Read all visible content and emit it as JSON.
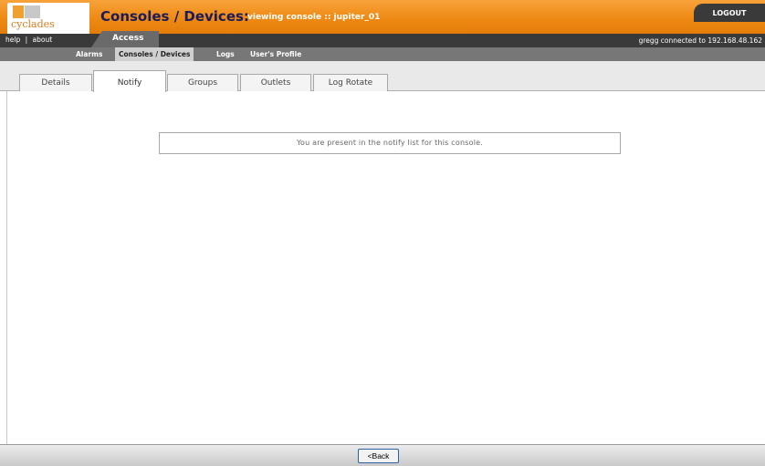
{
  "header": {
    "logo_text": "cyclades",
    "title": "Consoles / Devices:",
    "viewing": "viewing console :: jupiter_01",
    "logout_label": "LOGOUT"
  },
  "topbar": {
    "help_label": "help",
    "separator": "|",
    "about_label": "about",
    "access_label": "Access",
    "connected_text": "gregg connected to 192.168.48.162"
  },
  "subnav": {
    "items": [
      {
        "label": "Alarms"
      },
      {
        "label": "Consoles / Devices",
        "active": true
      },
      {
        "label": "Logs"
      },
      {
        "label": "User's Profile"
      }
    ]
  },
  "tabs": [
    {
      "label": "Details"
    },
    {
      "label": "Notify",
      "active": true
    },
    {
      "label": "Groups"
    },
    {
      "label": "Outlets"
    },
    {
      "label": "Log Rotate"
    }
  ],
  "main": {
    "notice": "You are present in the notify list for this console."
  },
  "footer": {
    "back_label": "<Back"
  },
  "colors": {
    "header_orange": "#ee8a14",
    "title_navy": "#1b1b5c",
    "dark_bar": "#3a3a3a",
    "subnav_gray": "#777777"
  }
}
